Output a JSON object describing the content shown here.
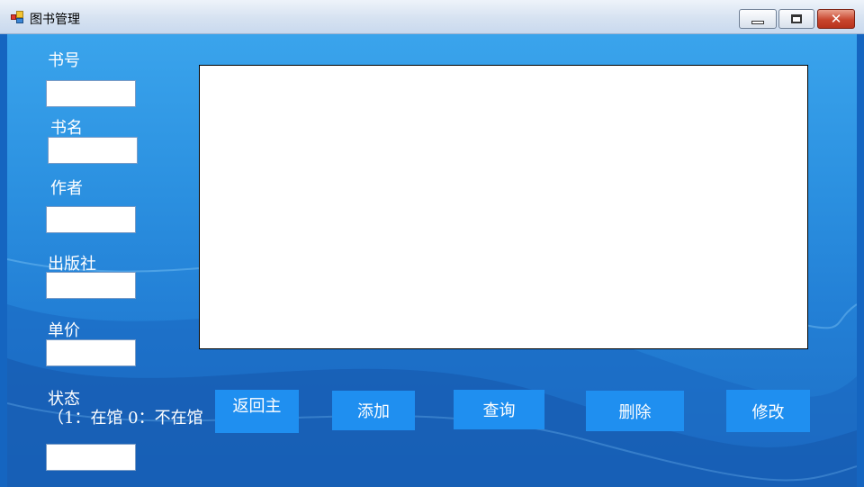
{
  "window": {
    "title": "图书管理"
  },
  "form": {
    "book_no_label": "书号",
    "book_name_label": "书名",
    "author_label": "作者",
    "publisher_label": "出版社",
    "price_label": "单价",
    "status_label": "状态",
    "status_hint": "（1：在馆 0：不在馆",
    "book_no_value": "",
    "book_name_value": "",
    "author_value": "",
    "publisher_value": "",
    "price_value": "",
    "status_value": ""
  },
  "buttons": {
    "back": "返回主",
    "add": "添加",
    "query": "查询",
    "delete": "删除",
    "modify": "修改"
  },
  "icons": [
    "app-icon",
    "minimize-icon",
    "maximize-icon",
    "close-icon"
  ],
  "colors": {
    "background": "#2b90e0",
    "button": "#1f8ff0",
    "close": "#c8462e"
  }
}
